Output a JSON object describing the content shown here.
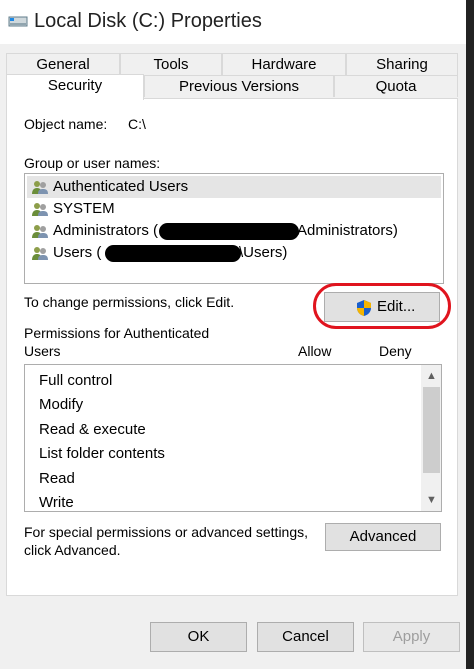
{
  "window": {
    "title": "Local Disk (C:) Properties"
  },
  "tabs": {
    "row1": [
      "General",
      "Tools",
      "Hardware",
      "Sharing"
    ],
    "row2": [
      "Security",
      "Previous Versions",
      "Quota"
    ],
    "active": "Security"
  },
  "security": {
    "object_name_label": "Object name:",
    "object_name_value": "C:\\",
    "group_label": "Group or user names:",
    "users": [
      {
        "name": "Authenticated Users",
        "selected": true
      },
      {
        "name": "SYSTEM",
        "selected": false
      },
      {
        "name_prefix": "Administrators (",
        "name_suffix": "Administrators)",
        "selected": false
      },
      {
        "name_prefix": "Users (",
        "name_suffix": "\\Users)",
        "selected": false
      }
    ],
    "change_text": "To change permissions, click Edit.",
    "edit_button": "Edit...",
    "permissions_for_line1": "Permissions for Authenticated",
    "permissions_for_line2": "Users",
    "allow_header": "Allow",
    "deny_header": "Deny",
    "permissions": [
      "Full control",
      "Modify",
      "Read & execute",
      "List folder contents",
      "Read",
      "Write"
    ],
    "special_line1": "For special permissions or advanced settings,",
    "special_line2": "click Advanced.",
    "advanced_button": "Advanced"
  },
  "footer": {
    "ok": "OK",
    "cancel": "Cancel",
    "apply": "Apply"
  },
  "colors": {
    "annotation": "#e0141e",
    "selected_row": "#e5e5e5",
    "button_bg": "#e1e1e1"
  }
}
